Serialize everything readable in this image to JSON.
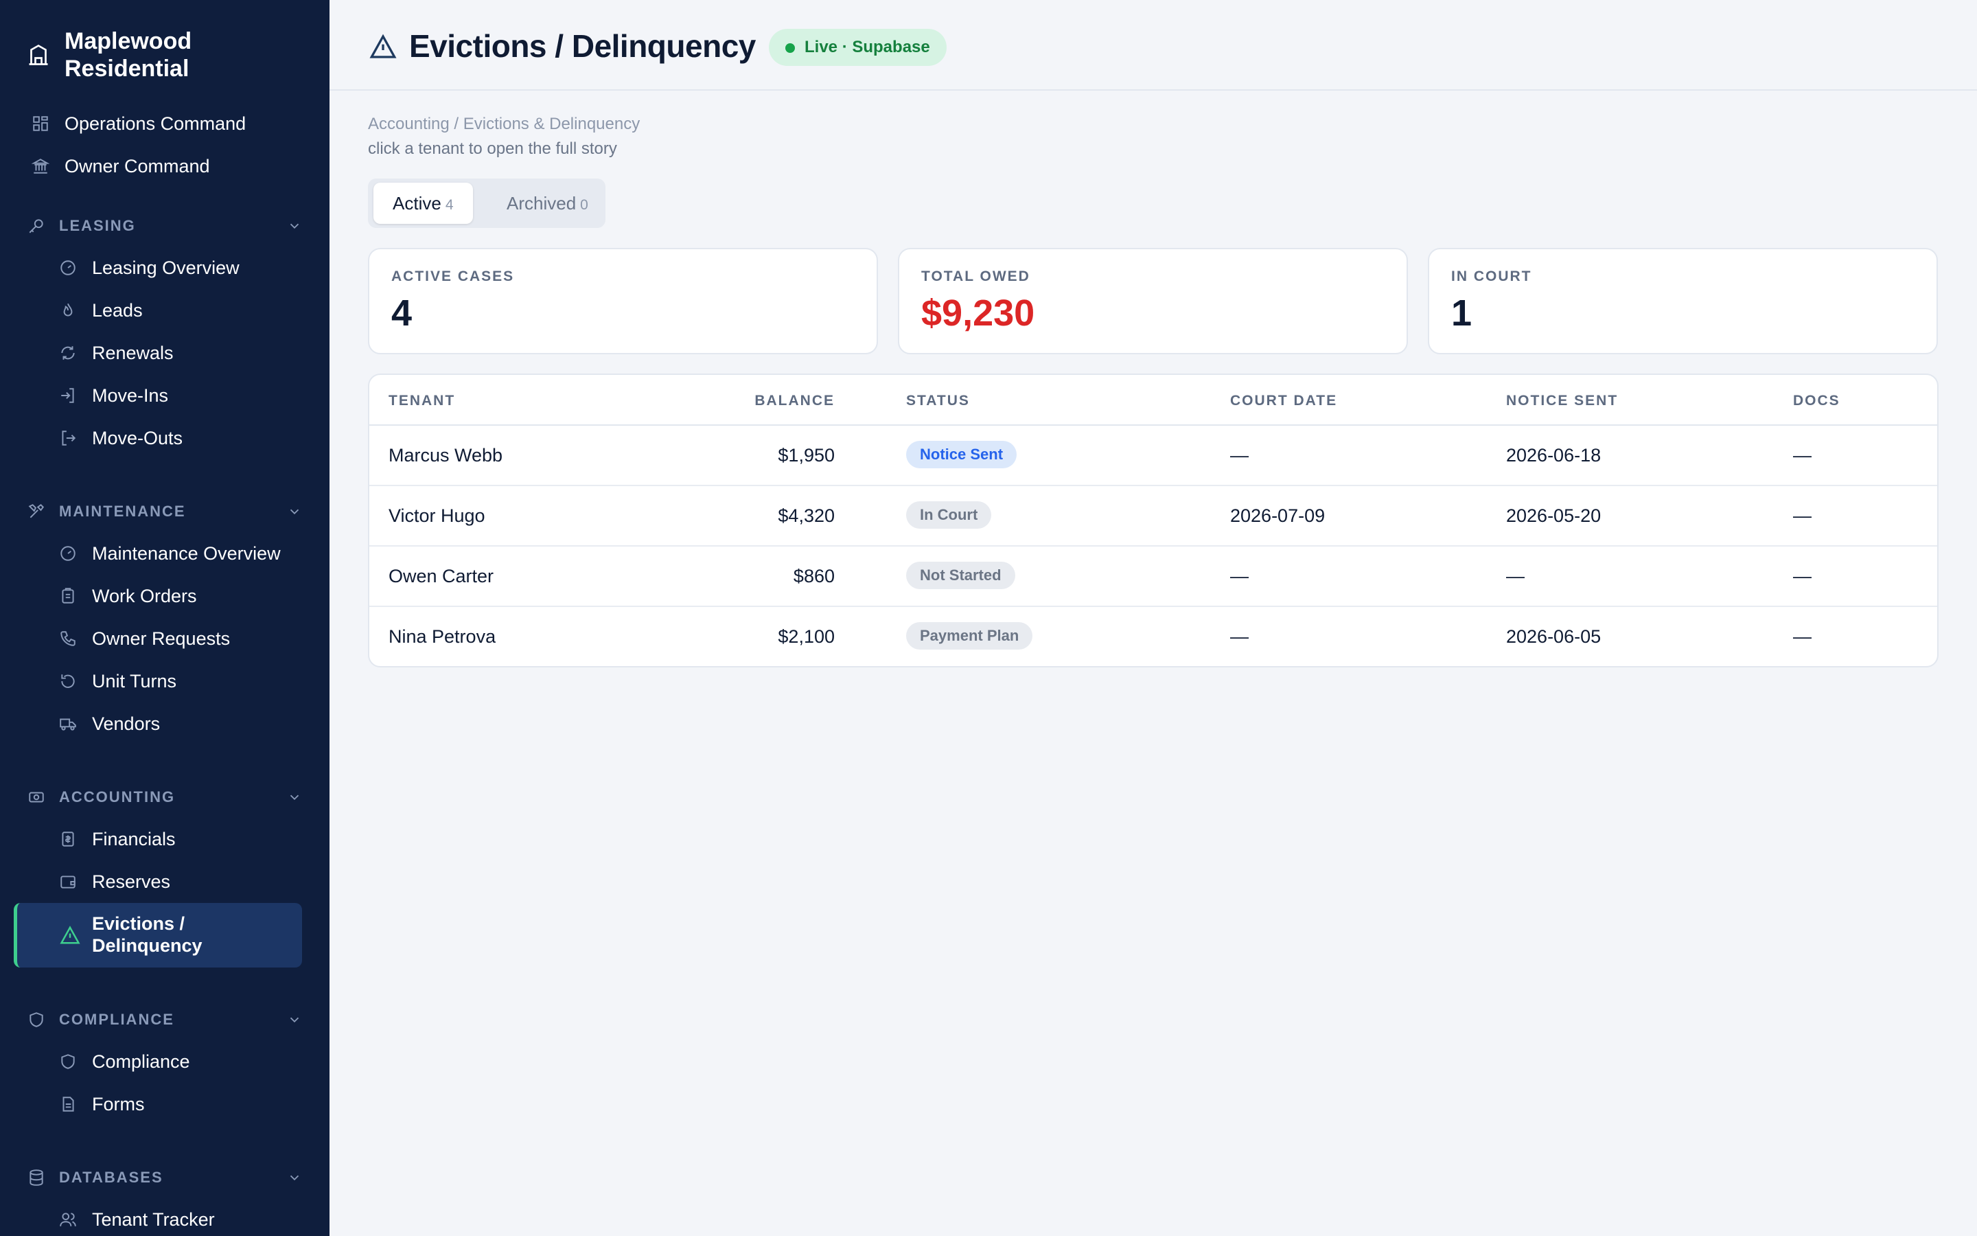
{
  "brand": {
    "name": "Maplewood Residential"
  },
  "nav": {
    "top": [
      {
        "label": "Operations Command"
      },
      {
        "label": "Owner Command"
      }
    ],
    "sections": [
      {
        "title": "LEASING",
        "items": [
          "Leasing Overview",
          "Leads",
          "Renewals",
          "Move-Ins",
          "Move-Outs"
        ]
      },
      {
        "title": "MAINTENANCE",
        "items": [
          "Maintenance Overview",
          "Work Orders",
          "Owner Requests",
          "Unit Turns",
          "Vendors"
        ]
      },
      {
        "title": "ACCOUNTING",
        "items": [
          "Financials",
          "Reserves",
          "Evictions / Delinquency"
        ]
      },
      {
        "title": "COMPLIANCE",
        "items": [
          "Compliance",
          "Forms"
        ]
      },
      {
        "title": "DATABASES",
        "items": [
          "Tenant Tracker"
        ]
      }
    ],
    "active_item": "Evictions / Delinquency"
  },
  "header": {
    "title": "Evictions / Delinquency",
    "badge": "Live · Supabase",
    "badge_color": "#15803d"
  },
  "main": {
    "breadcrumb": "Accounting / Evictions & Delinquency",
    "hint": "click a tenant to open the full story",
    "tabs": [
      {
        "label": "Active",
        "count": "4"
      },
      {
        "label": "Archived",
        "count": "0"
      }
    ],
    "stats": [
      {
        "label": "ACTIVE CASES",
        "value": "4"
      },
      {
        "label": "TOTAL OWED",
        "value": "$9,230",
        "color": "#dc2626"
      },
      {
        "label": "IN COURT",
        "value": "1"
      }
    ],
    "table": {
      "columns": [
        "TENANT",
        "BALANCE",
        "STATUS",
        "COURT DATE",
        "NOTICE SENT",
        "DOCS"
      ],
      "rows": [
        {
          "tenant": "Marcus Webb",
          "balance": "$1,950",
          "status": "Notice Sent",
          "court_date": "—",
          "notice_sent": "2026-06-18",
          "docs": "—"
        },
        {
          "tenant": "Victor Hugo",
          "balance": "$4,320",
          "status": "In Court",
          "court_date": "2026-07-09",
          "notice_sent": "2026-05-20",
          "docs": "—"
        },
        {
          "tenant": "Owen Carter",
          "balance": "$860",
          "status": "Not Started",
          "court_date": "—",
          "notice_sent": "—",
          "docs": "—"
        },
        {
          "tenant": "Nina Petrova",
          "balance": "$2,100",
          "status": "Payment Plan",
          "court_date": "—",
          "notice_sent": "2026-06-05",
          "docs": "—"
        }
      ]
    }
  },
  "colors": {
    "sidebar_bg": "#0f1e3d",
    "accent": "#3ecf8e",
    "danger": "#dc2626",
    "status_blue": "#2563eb"
  }
}
